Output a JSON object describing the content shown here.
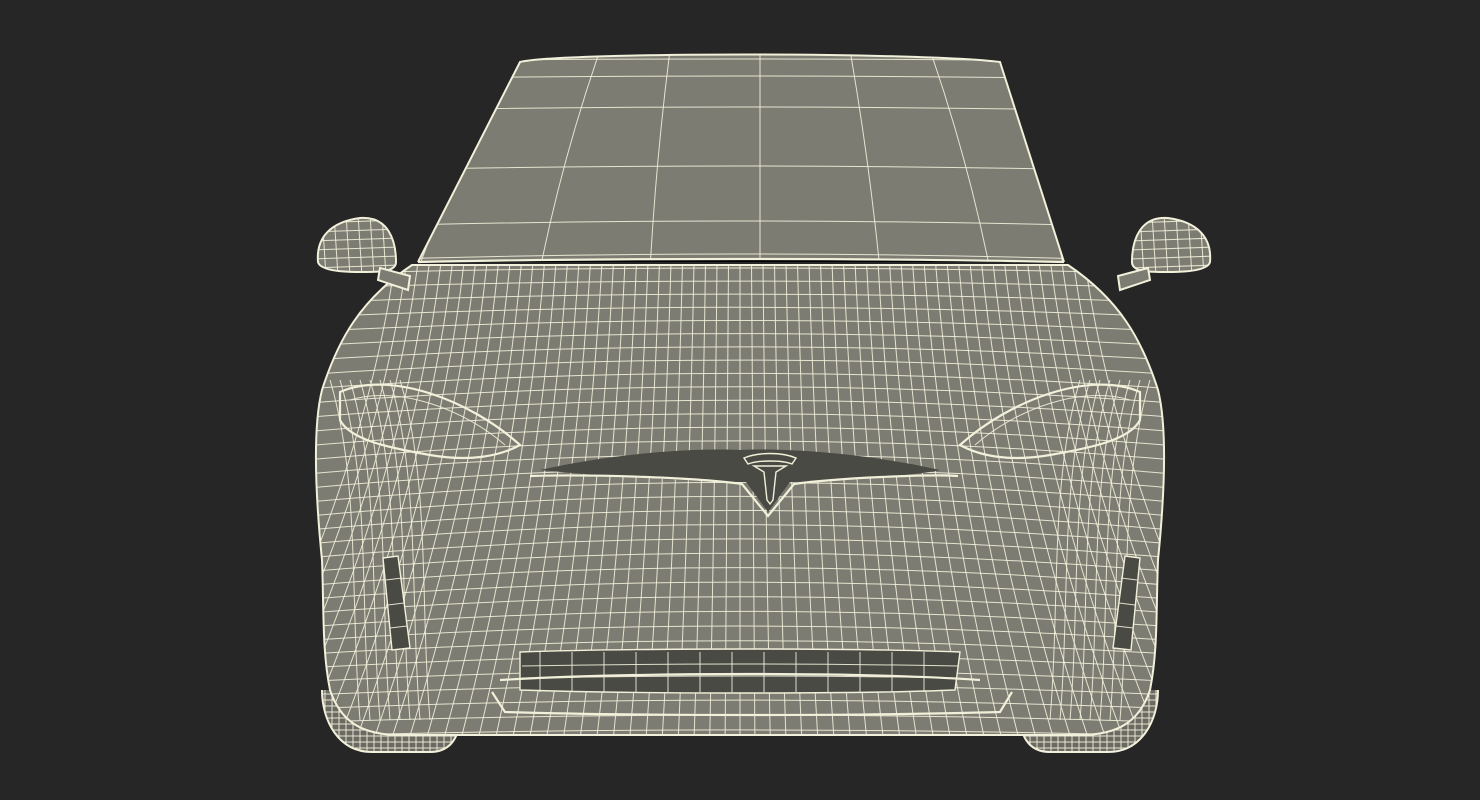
{
  "scene": {
    "background_color": "#262626",
    "subject": "car-wireframe-front-view",
    "shading": {
      "surface_fill": "#7d7c72",
      "surface_fill_dark": "#6b6a62",
      "wire_color": "#f1f0da",
      "shadow_fill": "#4a4a44"
    },
    "emblem_icon": "brand-logo-icon"
  }
}
